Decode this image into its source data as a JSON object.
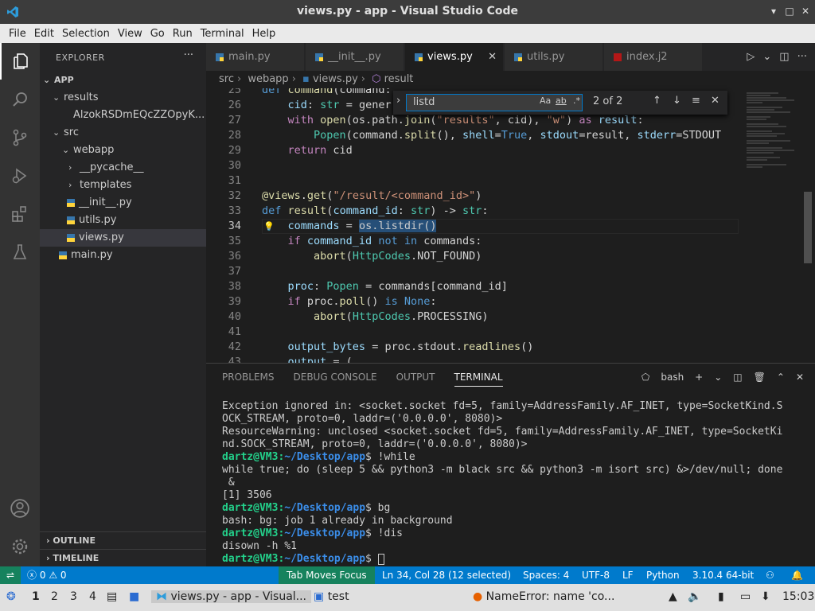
{
  "window": {
    "title": "views.py - app - Visual Studio Code"
  },
  "menu": [
    "File",
    "Edit",
    "Selection",
    "View",
    "Go",
    "Run",
    "Terminal",
    "Help"
  ],
  "sidebar": {
    "header": "EXPLORER",
    "project": "APP",
    "tree": [
      {
        "label": "results",
        "depth": 1,
        "type": "folder-open"
      },
      {
        "label": "AlzokRSDmEQcZZOpyK...",
        "depth": 2,
        "type": "file"
      },
      {
        "label": "src",
        "depth": 1,
        "type": "folder-open"
      },
      {
        "label": "webapp",
        "depth": 2,
        "type": "folder-open"
      },
      {
        "label": "__pycache__",
        "depth": 3,
        "type": "folder"
      },
      {
        "label": "templates",
        "depth": 3,
        "type": "folder"
      },
      {
        "label": "__init__.py",
        "depth": 3,
        "type": "py"
      },
      {
        "label": "utils.py",
        "depth": 3,
        "type": "py"
      },
      {
        "label": "views.py",
        "depth": 3,
        "type": "py",
        "selected": true
      },
      {
        "label": "main.py",
        "depth": 2,
        "type": "py"
      }
    ],
    "outline": "OUTLINE",
    "timeline": "TIMELINE"
  },
  "tabs": [
    {
      "label": "main.py",
      "active": false
    },
    {
      "label": "__init__.py",
      "active": false
    },
    {
      "label": "views.py",
      "active": true
    },
    {
      "label": "utils.py",
      "active": false
    },
    {
      "label": "index.j2",
      "active": false
    }
  ],
  "breadcrumb": [
    "src",
    "webapp",
    "views.py",
    "result"
  ],
  "find": {
    "query": "listd",
    "count": "2 of 2",
    "case": "Aa",
    "word": "ab",
    "regex": ".*"
  },
  "code": {
    "current_line": "34",
    "lines": [
      {
        "n": "25",
        "parts": [
          [
            "kw2",
            "def "
          ],
          [
            "fn",
            "command"
          ],
          [
            "pl",
            "(command:"
          ]
        ]
      },
      {
        "n": "26",
        "parts": [
          [
            "pl",
            "    "
          ],
          [
            "var",
            "cid"
          ],
          [
            "pl",
            ": "
          ],
          [
            "ty",
            "str"
          ],
          [
            "pl",
            " = gener"
          ]
        ]
      },
      {
        "n": "27",
        "parts": [
          [
            "pl",
            "    "
          ],
          [
            "kw",
            "with "
          ],
          [
            "fn",
            "open"
          ],
          [
            "pl",
            "(os.path."
          ],
          [
            "fn",
            "join"
          ],
          [
            "pl",
            "("
          ],
          [
            "str",
            "\"results\""
          ],
          [
            "pl",
            ", cid), "
          ],
          [
            "str",
            "\"w\""
          ],
          [
            "pl",
            ") "
          ],
          [
            "kw",
            "as "
          ],
          [
            "var",
            "result"
          ],
          [
            "pl",
            ":"
          ]
        ]
      },
      {
        "n": "28",
        "parts": [
          [
            "pl",
            "        "
          ],
          [
            "ty",
            "Popen"
          ],
          [
            "pl",
            "(command."
          ],
          [
            "fn",
            "split"
          ],
          [
            "pl",
            "(), "
          ],
          [
            "var",
            "shell"
          ],
          [
            "pl",
            "="
          ],
          [
            "kw2",
            "True"
          ],
          [
            "pl",
            ", "
          ],
          [
            "var",
            "stdout"
          ],
          [
            "pl",
            "=result, "
          ],
          [
            "var",
            "stderr"
          ],
          [
            "pl",
            "=STDOUT"
          ]
        ]
      },
      {
        "n": "29",
        "parts": [
          [
            "pl",
            "    "
          ],
          [
            "kw",
            "return "
          ],
          [
            "pl",
            "cid"
          ]
        ]
      },
      {
        "n": "30",
        "parts": []
      },
      {
        "n": "31",
        "parts": []
      },
      {
        "n": "32",
        "parts": [
          [
            "dec",
            "@views"
          ],
          [
            "pl",
            "."
          ],
          [
            "fn",
            "get"
          ],
          [
            "pl",
            "("
          ],
          [
            "str",
            "\"/result/<command_id>\""
          ],
          [
            "pl",
            ")"
          ]
        ]
      },
      {
        "n": "33",
        "parts": [
          [
            "kw2",
            "def "
          ],
          [
            "fn",
            "result"
          ],
          [
            "pl",
            "("
          ],
          [
            "var",
            "command_id"
          ],
          [
            "pl",
            ": "
          ],
          [
            "ty",
            "str"
          ],
          [
            "pl",
            ") -> "
          ],
          [
            "ty",
            "str"
          ],
          [
            "pl",
            ":"
          ]
        ]
      },
      {
        "n": "34",
        "parts": [
          [
            "pl",
            "    "
          ],
          [
            "var",
            "commands"
          ],
          [
            "pl",
            " = "
          ],
          [
            "hl",
            "os.listdir()"
          ]
        ]
      },
      {
        "n": "35",
        "parts": [
          [
            "pl",
            "    "
          ],
          [
            "kw",
            "if "
          ],
          [
            "var",
            "command_id"
          ],
          [
            "pl",
            " "
          ],
          [
            "kw2",
            "not in"
          ],
          [
            "pl",
            " commands:"
          ]
        ]
      },
      {
        "n": "36",
        "parts": [
          [
            "pl",
            "        "
          ],
          [
            "fn",
            "abort"
          ],
          [
            "pl",
            "("
          ],
          [
            "ty",
            "HttpCodes"
          ],
          [
            "pl",
            ".NOT_FOUND)"
          ]
        ]
      },
      {
        "n": "37",
        "parts": []
      },
      {
        "n": "38",
        "parts": [
          [
            "pl",
            "    "
          ],
          [
            "var",
            "proc"
          ],
          [
            "pl",
            ": "
          ],
          [
            "ty",
            "Popen"
          ],
          [
            "pl",
            " = commands[command_id]"
          ]
        ]
      },
      {
        "n": "39",
        "parts": [
          [
            "pl",
            "    "
          ],
          [
            "kw",
            "if "
          ],
          [
            "pl",
            "proc."
          ],
          [
            "fn",
            "poll"
          ],
          [
            "pl",
            "() "
          ],
          [
            "kw2",
            "is None"
          ],
          [
            "pl",
            ":"
          ]
        ]
      },
      {
        "n": "40",
        "parts": [
          [
            "pl",
            "        "
          ],
          [
            "fn",
            "abort"
          ],
          [
            "pl",
            "("
          ],
          [
            "ty",
            "HttpCodes"
          ],
          [
            "pl",
            ".PROCESSING)"
          ]
        ]
      },
      {
        "n": "41",
        "parts": []
      },
      {
        "n": "42",
        "parts": [
          [
            "pl",
            "    "
          ],
          [
            "var",
            "output_bytes"
          ],
          [
            "pl",
            " = proc.stdout."
          ],
          [
            "fn",
            "readlines"
          ],
          [
            "pl",
            "()"
          ]
        ]
      },
      {
        "n": "43",
        "parts": [
          [
            "pl",
            "    "
          ],
          [
            "var",
            "output"
          ],
          [
            "pl",
            " = ("
          ]
        ]
      }
    ]
  },
  "panel": {
    "tabs": [
      "PROBLEMS",
      "DEBUG CONSOLE",
      "OUTPUT",
      "TERMINAL"
    ],
    "active_tab": "TERMINAL",
    "shell": "bash",
    "terminal": [
      {
        "text": "Exception ignored in: <socket.socket fd=5, family=AddressFamily.AF_INET, type=SocketKind.S"
      },
      {
        "text": "OCK_STREAM, proto=0, laddr=('0.0.0.0', 8080)>"
      },
      {
        "text": "ResourceWarning: unclosed <socket.socket fd=5, family=AddressFamily.AF_INET, type=SocketKi"
      },
      {
        "text": "nd.SOCK_STREAM, proto=0, laddr=('0.0.0.0', 8080)>"
      },
      {
        "user": "dartz@VM3",
        "path": "~/Desktop/app",
        "cmd": "$ !while"
      },
      {
        "text": "while true; do (sleep 5 && python3 -m black src && python3 -m isort src) &>/dev/null; done"
      },
      {
        "text": " &"
      },
      {
        "text": "[1] 3506"
      },
      {
        "user": "dartz@VM3",
        "path": "~/Desktop/app",
        "cmd": "$ bg"
      },
      {
        "text": "bash: bg: job 1 already in background"
      },
      {
        "user": "dartz@VM3",
        "path": "~/Desktop/app",
        "cmd": "$ !dis"
      },
      {
        "text": "disown -h %1"
      },
      {
        "user": "dartz@VM3",
        "path": "~/Desktop/app",
        "cmd": "$ ",
        "cursor": true
      }
    ]
  },
  "status": {
    "errors": "0",
    "warnings": "0",
    "tab_moves_focus": "Tab Moves Focus",
    "position": "Ln 34, Col 28 (12 selected)",
    "spaces": "Spaces: 4",
    "encoding": "UTF-8",
    "eol": "LF",
    "language": "Python",
    "interpreter": "3.10.4 64-bit"
  },
  "taskbar": {
    "workspaces": [
      "1",
      "2",
      "3",
      "4"
    ],
    "active_workspace": "1",
    "windows": [
      {
        "label": "views.py - app - Visual...",
        "active": true
      },
      {
        "label": "test",
        "active": false
      },
      {
        "label": "NameError: name 'co...",
        "active": false
      }
    ],
    "clock": "15:03"
  },
  "colors": {
    "accent": "#007acc",
    "activity_bg": "#333333",
    "sidebar_bg": "#252526",
    "editor_bg": "#1e1e1e"
  }
}
